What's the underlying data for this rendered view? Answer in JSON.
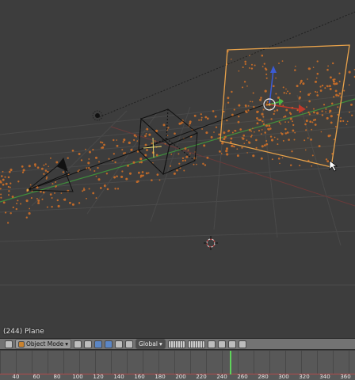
{
  "viewport": {
    "object_info": "(244) Plane"
  },
  "header": {
    "mode": "Object Mode",
    "orientation": "Global",
    "icons": [
      "editor-type-icon",
      "mode-icon",
      "shading-icon",
      "pivot-icon",
      "manipulator-icon",
      "translate-icon",
      "rotate-icon",
      "scale-icon",
      "layers-icon",
      "lock-icon",
      "snap-icon",
      "proportional-icon",
      "render-icon"
    ]
  },
  "timeline": {
    "ticks": [
      "40",
      "60",
      "80",
      "100",
      "120",
      "140",
      "160",
      "180",
      "200",
      "220",
      "240",
      "260",
      "280",
      "300",
      "320",
      "340",
      "360"
    ],
    "current_frame": 244
  },
  "colors": {
    "background": "#3d3d3d",
    "selected_outline": "#e8a24a",
    "axis_x": "#c0392b",
    "axis_y": "#48b544",
    "axis_z": "#3b5bd6",
    "particles": "#c06a2a"
  }
}
